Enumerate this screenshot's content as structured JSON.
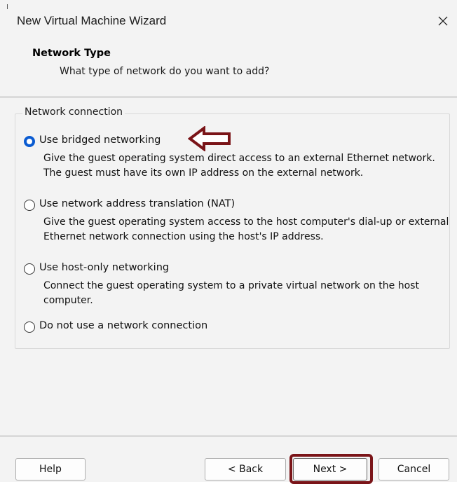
{
  "window": {
    "title": "New Virtual Machine Wizard",
    "close_icon": "close-icon"
  },
  "header": {
    "title": "Network Type",
    "subtitle": "What type of network do you want to add?"
  },
  "group": {
    "legend": "Network connection",
    "options": [
      {
        "label": "Use bridged networking",
        "description": "Give the guest operating system direct access to an external Ethernet network. The guest must have its own IP address on the external network.",
        "checked": true
      },
      {
        "label": "Use network address translation (NAT)",
        "description": "Give the guest operating system access to the host computer's dial-up or external Ethernet network connection using the host's IP address.",
        "checked": false
      },
      {
        "label": "Use host-only networking",
        "description": "Connect the guest operating system to a private virtual network on the host computer.",
        "checked": false
      },
      {
        "label": "Do not use a network connection",
        "description": "",
        "checked": false
      }
    ]
  },
  "footer": {
    "help_label": "Help",
    "back_label": "< Back",
    "next_label": "Next >",
    "cancel_label": "Cancel"
  },
  "colors": {
    "accent": "#0a5bd1",
    "annotation": "#7a1418",
    "background": "#f3f3f3"
  },
  "annotations": {
    "arrow_icon": "left-arrow-annotation-icon",
    "next_highlight": "next-button-highlight-box"
  }
}
